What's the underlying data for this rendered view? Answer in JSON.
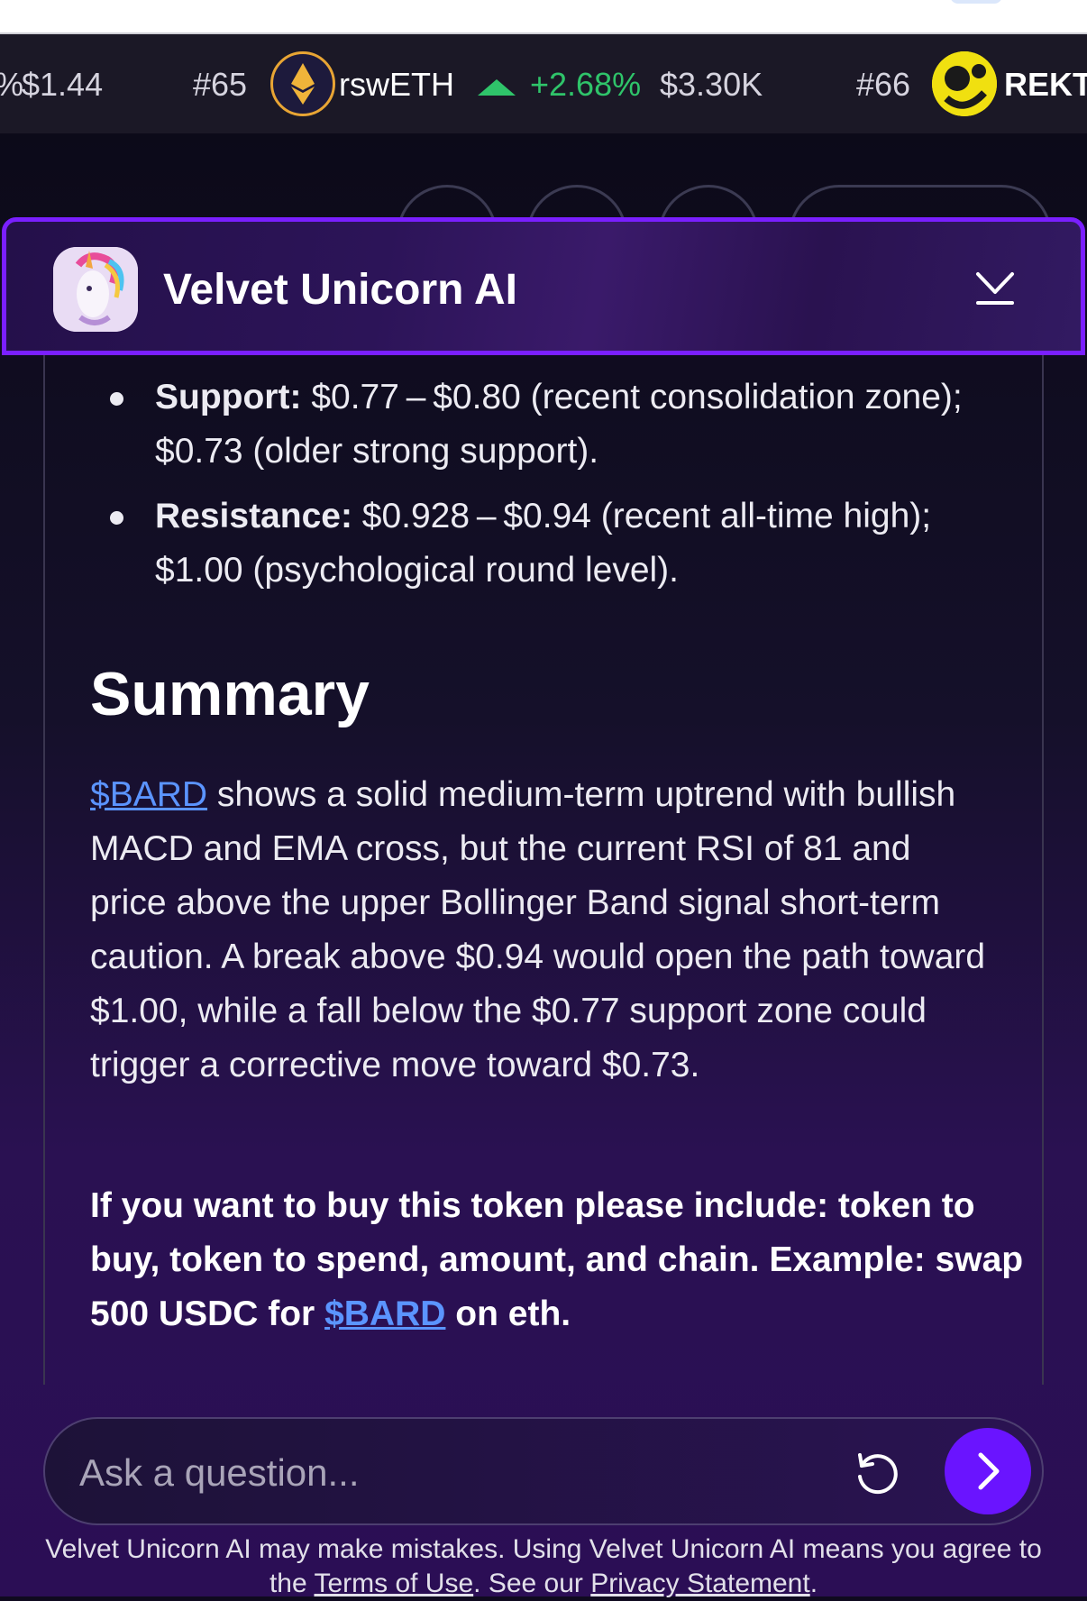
{
  "ticker": {
    "items": [
      {
        "partial_change": "%",
        "price": "$1.44"
      },
      {
        "rank": "#65",
        "symbol": "rswETH",
        "change": "+2.68%",
        "price": "$3.30K",
        "icon": "eth-icon"
      },
      {
        "rank": "#66",
        "symbol": "REKT",
        "icon": "rekt-coin-icon"
      }
    ],
    "colors": {
      "positive": "#2fc46a"
    }
  },
  "header": {
    "title": "Velvet Unicorn AI",
    "accent": "#7a1fff"
  },
  "chat": {
    "levels": [
      {
        "label": "Support:",
        "text": "$0.77 – $0.80 (recent consolidation zone); $0.73 (older strong support)."
      },
      {
        "label": "Resistance:",
        "text": "$0.928 – $0.94 (recent all-time high); $1.00 (psychological round level)."
      }
    ],
    "summary_heading": "Summary",
    "summary_link": "$BARD",
    "summary_text": "shows a solid medium-term uptrend with bullish MACD and EMA cross, but the current RSI of 81 and price above the upper Bollinger Band signal short-term caution. A break above $0.94 would open the path toward $1.00, while a fall below the $0.77 support zone could trigger a corrective move toward $0.73.",
    "cta_text_1": "If you want to buy this token please include: token to buy, token to spend, amount, and chain. Example: swap 500 USDC for",
    "cta_link": "$BARD",
    "cta_text_2": "on eth."
  },
  "composer": {
    "placeholder": "Ask a question...",
    "send_color": "#6a14ff"
  },
  "footer": {
    "disclaimer_1": "Velvet Unicorn AI may make mistakes. Using Velvet Unicorn AI means you agree to the",
    "terms_link": "Terms of Use",
    "disclaimer_2": ". See our",
    "privacy_link": "Privacy Statement",
    "disclaimer_3": "."
  }
}
